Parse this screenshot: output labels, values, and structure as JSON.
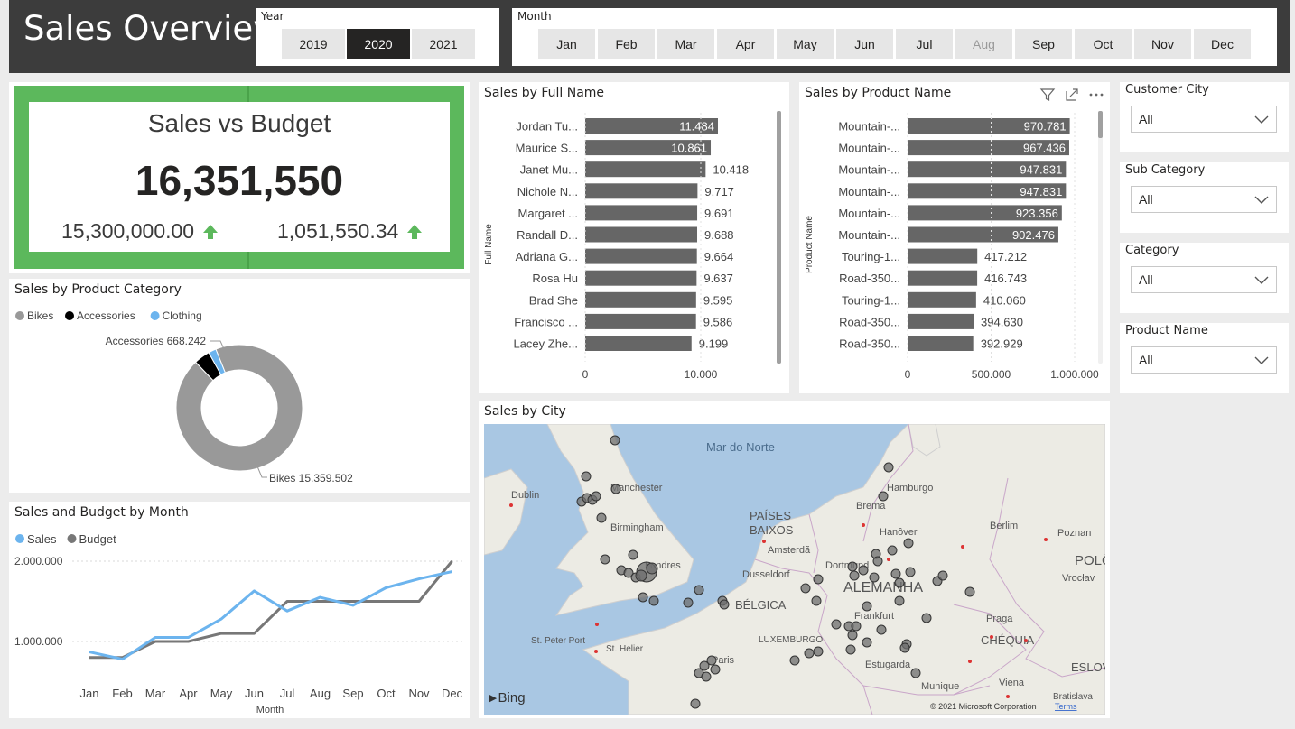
{
  "header": {
    "title": "Sales Overview"
  },
  "year_slicer": {
    "label": "Year",
    "options": [
      "2019",
      "2020",
      "2021"
    ],
    "selected": "2020"
  },
  "month_slicer": {
    "label": "Month",
    "options": [
      "Jan",
      "Feb",
      "Mar",
      "Apr",
      "May",
      "Jun",
      "Jul",
      "Aug",
      "Sep",
      "Oct",
      "Nov",
      "Dec"
    ],
    "dimmed": [
      "Aug"
    ]
  },
  "kpi": {
    "title": "Sales vs Budget",
    "value": "16,351,550",
    "budget": "15,300,000.00",
    "variance": "1,051,550.34",
    "accent": "#5cb85c"
  },
  "filters": [
    {
      "label": "Customer City",
      "value": "All"
    },
    {
      "label": "Sub Category",
      "value": "All"
    },
    {
      "label": "Category",
      "value": "All"
    },
    {
      "label": "Product Name",
      "value": "All"
    }
  ],
  "visual_icons": [
    "filter-icon",
    "focus-mode-icon",
    "more-options-icon"
  ],
  "map": {
    "title": "Sales by City",
    "labels": [
      "Mar do Norte",
      "Dublin",
      "Manchester",
      "Birmingham",
      "Londres",
      "St. Peter Port",
      "St. Helier",
      "Paris",
      "PAÍSES",
      "BAIXOS",
      "Amsterdã",
      "Dusseldorf",
      "BÉLGICA",
      "LUXEMBURGO",
      "Hamburgo",
      "Brema",
      "Hanôver",
      "Berlim",
      "Poznan",
      "POLÔ",
      "Vrocłav",
      "Dortmund",
      "ALEMANHA",
      "Frankfurt",
      "Praga",
      "CHÉQUIA",
      "Estugarda",
      "Munique",
      "Viena",
      "ESLOV",
      "Bratislava"
    ],
    "brand": "Bing",
    "copyright": "© 2021 Microsoft Corporation",
    "terms": "Terms"
  },
  "chart_data": [
    {
      "type": "bar",
      "orientation": "horizontal",
      "title": "Sales by Full Name",
      "ylabel": "Full Name",
      "categories": [
        "Jordan Tu...",
        "Maurice S...",
        "Janet Mu...",
        "Nichole N...",
        "Margaret ...",
        "Randall D...",
        "Adriana G...",
        "Rosa Hu",
        "Brad She",
        "Francisco ...",
        "Lacey Zhe..."
      ],
      "values": [
        11484,
        10861,
        10418,
        9717,
        9691,
        9688,
        9664,
        9637,
        9595,
        9586,
        9199
      ],
      "value_labels": [
        "11.484",
        "10.861",
        "10.418",
        "9.717",
        "9.691",
        "9.688",
        "9.664",
        "9.637",
        "9.595",
        "9.586",
        "9.199"
      ],
      "xlim": [
        0,
        15000
      ],
      "x_ticks": [
        "0",
        "10.000"
      ],
      "color": "#666666"
    },
    {
      "type": "bar",
      "orientation": "horizontal",
      "title": "Sales by Product Name",
      "ylabel": "Product Name",
      "categories": [
        "Mountain-...",
        "Mountain-...",
        "Mountain-...",
        "Mountain-...",
        "Mountain-...",
        "Mountain-...",
        "Touring-1...",
        "Road-350...",
        "Touring-1...",
        "Road-350...",
        "Road-350..."
      ],
      "values": [
        970781,
        967436,
        947831,
        947831,
        923356,
        902476,
        417212,
        416743,
        410060,
        394630,
        392929
      ],
      "value_labels": [
        "970.781",
        "967.436",
        "947.831",
        "947.831",
        "923.356",
        "902.476",
        "417.212",
        "416.743",
        "410.060",
        "394.630",
        "392.929"
      ],
      "xlim": [
        0,
        1000000
      ],
      "x_ticks": [
        "0",
        "500.000",
        "1.000.000"
      ],
      "color": "#666666"
    },
    {
      "type": "pie",
      "donut": true,
      "title": "Sales by Product Category",
      "legend_position": "top-left",
      "slices": [
        {
          "name": "Bikes",
          "value": 15359502,
          "label": "Bikes 15.359.502",
          "color": "#999999"
        },
        {
          "name": "Accessories",
          "value": 668242,
          "label": "Accessories 668.242",
          "color": "#000000"
        },
        {
          "name": "Clothing",
          "value": 323806,
          "label": "",
          "color": "#6cb4ee"
        }
      ]
    },
    {
      "type": "line",
      "title": "Sales and Budget by Month",
      "xlabel": "Month",
      "legend_position": "top-left",
      "categories": [
        "Jan",
        "Feb",
        "Mar",
        "Apr",
        "May",
        "Jun",
        "Jul",
        "Aug",
        "Sep",
        "Oct",
        "Nov",
        "Dec"
      ],
      "ylim": [
        500000,
        2100000
      ],
      "y_ticks": [
        {
          "value": 1000000,
          "label": "1.000.000"
        },
        {
          "value": 2000000,
          "label": "2.000.000"
        }
      ],
      "series": [
        {
          "name": "Sales",
          "color": "#6cb4ee",
          "values": [
            870000,
            780000,
            1050000,
            1050000,
            1280000,
            1630000,
            1380000,
            1550000,
            1450000,
            1670000,
            1780000,
            1870000
          ]
        },
        {
          "name": "Budget",
          "color": "#777777",
          "values": [
            800000,
            800000,
            1000000,
            1000000,
            1100000,
            1100000,
            1500000,
            1500000,
            1500000,
            1500000,
            1500000,
            2000000
          ]
        }
      ]
    }
  ]
}
